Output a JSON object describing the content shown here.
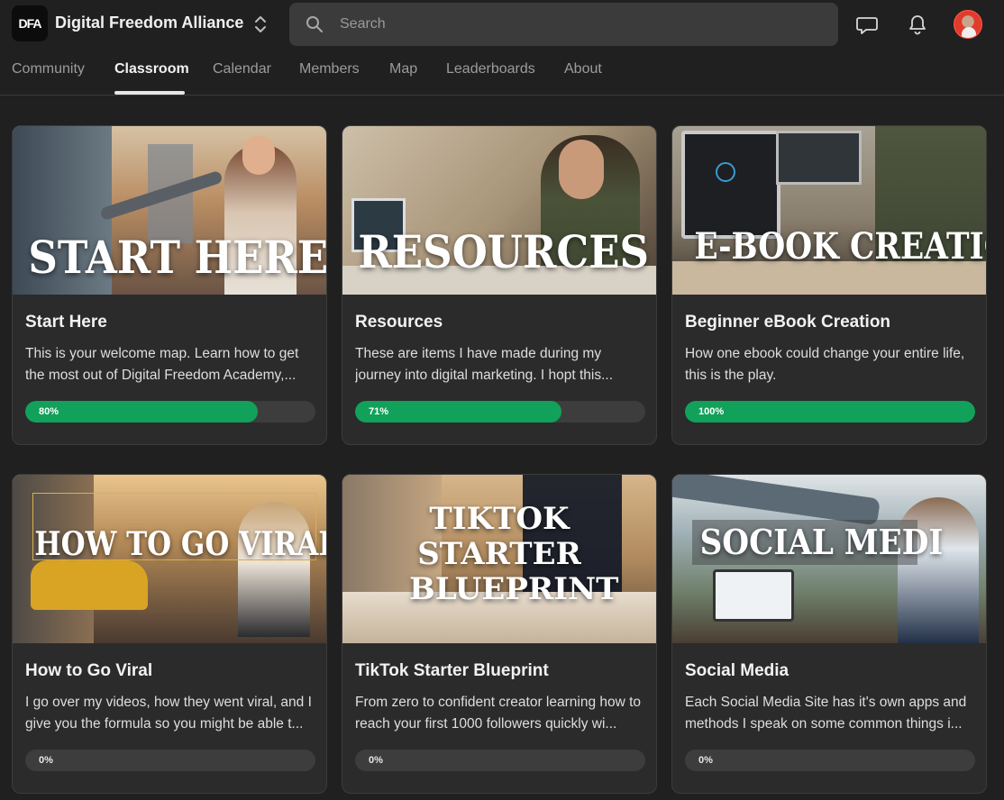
{
  "app": {
    "logo_text": "DFA",
    "brand": "Digital Freedom Alliance"
  },
  "search": {
    "placeholder": "Search"
  },
  "tabs": [
    {
      "label": "Community"
    },
    {
      "label": "Classroom",
      "active": true
    },
    {
      "label": "Calendar"
    },
    {
      "label": "Members"
    },
    {
      "label": "Map"
    },
    {
      "label": "Leaderboards"
    },
    {
      "label": "About"
    }
  ],
  "courses": [
    {
      "overlay": "START HERE",
      "title": "Start Here",
      "description": "This is your welcome map. Learn how to get the most out of Digital Freedom Academy,...",
      "progress": 0.8,
      "progress_label": "80%"
    },
    {
      "overlay": "RESOURCES",
      "title": "Resources",
      "description": "These are items I have made during my journey into digital marketing. I hopt this...",
      "progress": 0.71,
      "progress_label": "71%"
    },
    {
      "overlay": "E-BOOK CREATION",
      "title": "Beginner eBook Creation",
      "description": "How one ebook could change your entire life, this is the play.",
      "progress": 1.0,
      "progress_label": "100%"
    },
    {
      "overlay": "HOW TO GO VIRAL",
      "title": "How to Go Viral",
      "description": "I go over my videos, how they went viral, and I give you the formula so you might be able t...",
      "progress": 0,
      "progress_label": "0%"
    },
    {
      "overlay": "TIKTOK STARTER BLUEPRINT",
      "title": "TikTok Starter Blueprint",
      "description": "From zero to confident creator learning how to reach your first 1000 followers quickly wi...",
      "progress": 0,
      "progress_label": "0%"
    },
    {
      "overlay": "SOCIAL MEDI",
      "title": "Social Media",
      "description": "Each Social Media Site has it's own apps and methods I speak on some common things i...",
      "progress": 0,
      "progress_label": "0%"
    }
  ],
  "colors": {
    "background": "#202020",
    "card": "#2b2b2b",
    "progress_fill": "#12a15a",
    "progress_track": "#3d3d3d"
  },
  "icons": [
    "switcher-chevrons-icon",
    "search-icon",
    "chat-icon",
    "bell-icon"
  ]
}
